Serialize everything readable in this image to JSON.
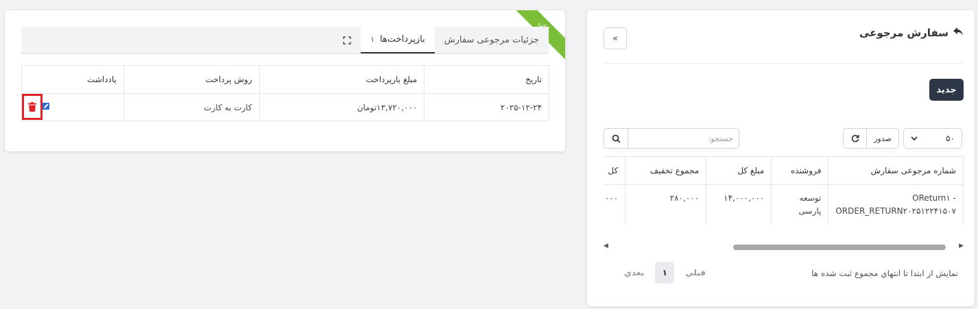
{
  "list_panel": {
    "title": "سفارش مرجوعی",
    "title_icon": "reply-icon",
    "collapse_label": "«",
    "new_button": "جدید",
    "page_size": "۵۰",
    "export_label": "صدور",
    "search_placeholder": "جستجو:",
    "columns": [
      "شماره مرجوعی سفارش",
      "فروشنده",
      "مبلغ کل",
      "مجموع تخفیف",
      "کل"
    ],
    "rows": [
      {
        "order_no": "OReturn۱ - ORDER_RETURN۲۰۲۵۱۲۲۴۱۵۰۷",
        "seller": "توسعه پارسی",
        "total": "۱۴,۰۰۰,۰۰۰",
        "discount": "۲۸۰,۰۰۰",
        "net": "۰۰۰"
      }
    ],
    "footer_info": "نمایش از ابتدا تا انتهاي مجموع ثبت شده ها",
    "pager": {
      "prev": "قبلي",
      "current": "۱",
      "next": "بعدي"
    }
  },
  "detail_panel": {
    "ribbon": "پایان",
    "tabs": [
      {
        "label": "جزئیات مرجوعی سفارش",
        "count": ""
      },
      {
        "label": "بازپرداخت‌ها",
        "count": "۱"
      }
    ],
    "expand_icon": "expand-icon",
    "columns": [
      "تاریخ",
      "مبلغ بازپرداخت",
      "روش پرداخت",
      "یادداشت"
    ],
    "rows": [
      {
        "date": "۲۰۲۵-۱۲-۲۴",
        "amount": "۱۳,۷۲۰,۰۰۰تومان",
        "method": "کارت به کارت",
        "note": ""
      }
    ]
  },
  "colors": {
    "accent_dark": "#2d3646",
    "ribbon_green": "#7bbe3a",
    "highlight_red": "#e0222a"
  }
}
